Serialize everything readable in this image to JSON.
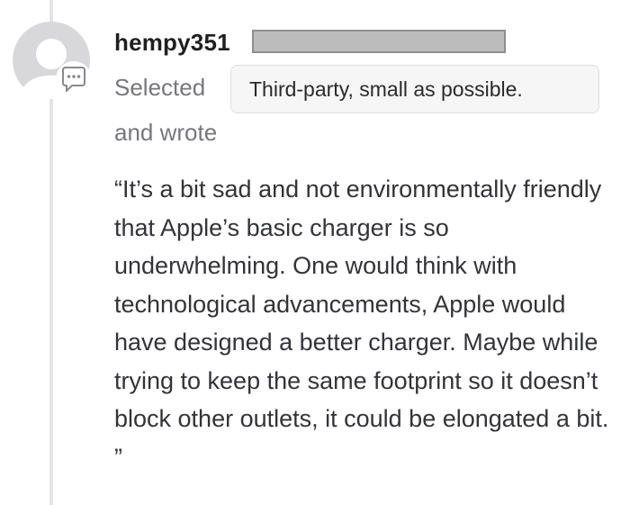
{
  "comment": {
    "username": "hempy351",
    "selected_label": "Selected",
    "selected_choice": "Third-party, small as possible.",
    "wrote_label": "and wrote",
    "quote": "“It’s a bit sad and not environmentally friendly that Apple’s basic charger is so underwhelming. One would think with technological advancements, Apple would have designed a better charger. Maybe while trying to keep the same footprint so it doesn’t block other outlets, it could be elongated a bit. ”"
  },
  "icons": {
    "avatar": "default-avatar-icon",
    "badge": "comment-bubble-icon"
  },
  "colors": {
    "avatar": "#d8d8db",
    "badge_border": "#8a8a8e",
    "thread_line": "#e4e4e7",
    "muted_text": "#76777b",
    "pill_background": "#f6f6f7",
    "redaction": "#bcbcbc"
  }
}
